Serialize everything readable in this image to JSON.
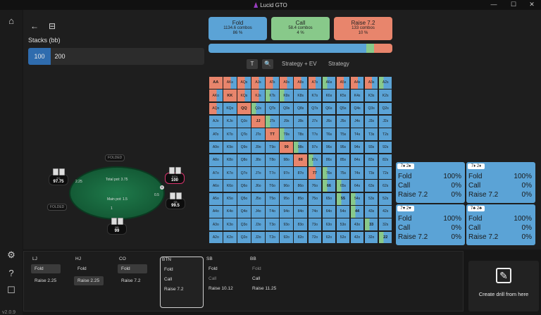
{
  "window": {
    "title": "Lucid GTO",
    "controls": [
      "—",
      "☐",
      "✕"
    ]
  },
  "sidebar": {
    "icons": [
      "home-icon",
      "gear-icon",
      "help-icon",
      "feedback-icon"
    ],
    "version": "v2.0.9"
  },
  "toolbar": {
    "back": "←",
    "calendar": "⊟"
  },
  "stacks": {
    "label": "Stacks (bb)",
    "options": [
      "100",
      "200"
    ],
    "selected": "100"
  },
  "actions": [
    {
      "name": "Fold",
      "combos": "1134.6 combos",
      "pct": "86 %",
      "color": "#5ba3d6"
    },
    {
      "name": "Call",
      "combos": "58.4 combos",
      "pct": "4 %",
      "color": "#88c98a"
    },
    {
      "name": "Raise 7.2",
      "combos": "133 combos",
      "pct": "10 %",
      "color": "#e8856c"
    }
  ],
  "freq": {
    "fold": 86,
    "call": 4,
    "raise": 10
  },
  "view": {
    "t": "T",
    "search": "🔍",
    "strategy_ev": "Strategy + EV",
    "strategy": "Strategy"
  },
  "table": {
    "pot_total": "Total pot: 3.75",
    "pot_main": "Main pot: 1.5",
    "seats": [
      {
        "pos": "HJ",
        "stack": "97.75",
        "bet": "2.25"
      },
      {
        "pos": "BTN",
        "stack": "100",
        "bet": ""
      },
      {
        "pos": "SB",
        "stack": "99.5",
        "bet": "0.5"
      },
      {
        "pos": "BB",
        "stack": "99",
        "bet": "1"
      }
    ],
    "folded": [
      "FOLDED",
      "FOLDED"
    ],
    "btn_label": "D"
  },
  "grid": {
    "ranks": [
      "A",
      "K",
      "Q",
      "J",
      "T",
      "9",
      "8",
      "7",
      "6",
      "5",
      "4",
      "3",
      "2"
    ]
  },
  "combos": [
    {
      "cards": "7♠ 2♠",
      "fold": "100%",
      "call": "0%",
      "raise": "0%"
    },
    {
      "cards": "7♦ 2♦",
      "fold": "100%",
      "call": "0%",
      "raise": "0%"
    },
    {
      "cards": "7♥ 2♥",
      "fold": "100%",
      "call": "0%",
      "raise": "0%"
    },
    {
      "cards": "7♣ 2♣",
      "fold": "100%",
      "call": "0%",
      "raise": "0%"
    }
  ],
  "combo_labels": {
    "fold": "Fold",
    "call": "Call",
    "raise": "Raise 7.2"
  },
  "positions": [
    {
      "label": "LJ",
      "opts": [
        "Fold",
        "Raise 2.25"
      ],
      "sel": 0
    },
    {
      "label": "HJ",
      "opts": [
        "Fold",
        "Raise 2.25"
      ],
      "sel": 1
    },
    {
      "label": "CO",
      "opts": [
        "Fold",
        "Raise 7.2"
      ],
      "sel": 0
    },
    {
      "label": "BTN",
      "opts": [
        "Fold",
        "Call",
        "Raise 7.2"
      ],
      "sel": -1
    },
    {
      "label": "SB",
      "opts": [
        "Fold",
        "Call",
        "Raise 10.12"
      ],
      "sel": -1
    },
    {
      "label": "BB",
      "opts": [
        "Fold",
        "Call",
        "Raise 11.25"
      ],
      "sel": -1
    }
  ],
  "drill": {
    "label": "Create drill from here",
    "icon": "✎"
  },
  "colors": {
    "fold": "#5ba3d6",
    "call": "#88c98a",
    "raise": "#e8856c",
    "accent": "#2f6cae"
  }
}
